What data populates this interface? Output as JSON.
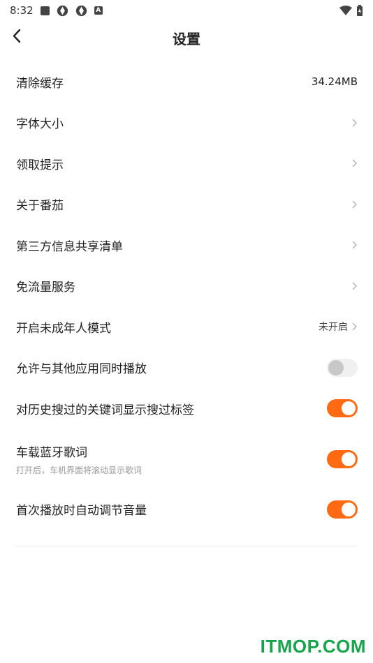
{
  "status": {
    "time": "8:32",
    "icons": [
      "stop-square-icon",
      "aperture-icon",
      "aperture-icon",
      "font-a-icon"
    ],
    "right_icons": [
      "wifi-icon",
      "battery-icon"
    ]
  },
  "header": {
    "title": "设置",
    "back_icon": "chevron-left-icon"
  },
  "rows": [
    {
      "label": "清除缓存",
      "value": "34.24MB",
      "chevron": false
    },
    {
      "label": "字体大小",
      "chevron": true
    },
    {
      "label": "领取提示",
      "chevron": true
    },
    {
      "label": "关于番茄",
      "chevron": true
    },
    {
      "label": "第三方信息共享清单",
      "chevron": true
    },
    {
      "label": "免流量服务",
      "chevron": true
    },
    {
      "label": "开启未成年人模式",
      "value": "未开启",
      "chevron": true
    },
    {
      "label": "允许与其他应用同时播放",
      "toggle": false
    },
    {
      "label": "对历史搜过的关键词显示搜过标签",
      "toggle": true
    },
    {
      "label": "车载蓝牙歌词",
      "sub": "打开后，车机界面将滚动显示歌词",
      "toggle": true
    },
    {
      "label": "首次播放时自动调节音量",
      "toggle": true
    }
  ],
  "colors": {
    "accent": "#ff6a13",
    "watermark": "#17a44b"
  },
  "watermark": "ITMOP.COM"
}
